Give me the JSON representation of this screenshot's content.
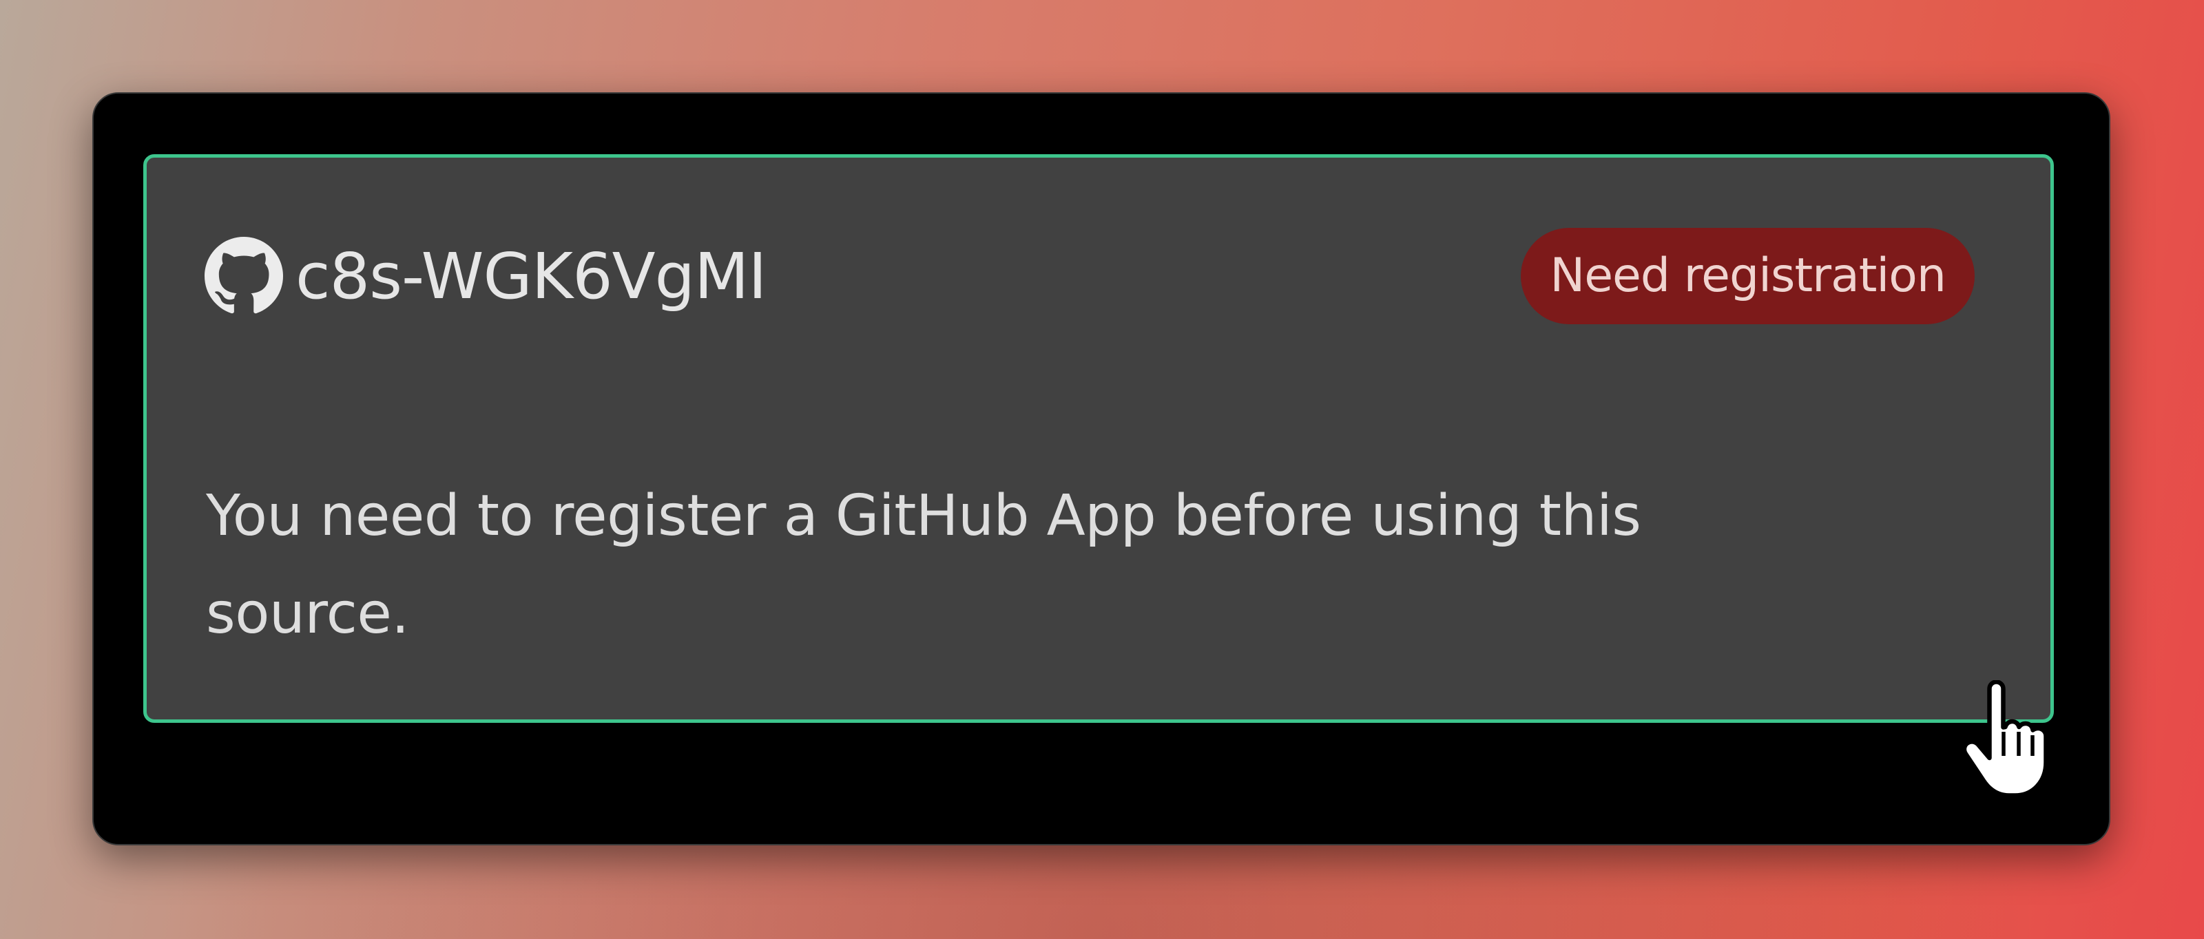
{
  "source_card": {
    "icon": "github-icon",
    "name": "c8s-WGK6VgMI",
    "status_badge": "Need registration",
    "message": "You need to register a GitHub App before using this source."
  },
  "cursor": {
    "icon": "hand-pointer-icon"
  },
  "colors": {
    "window_background": "#000000",
    "card_background": "#414141",
    "card_border": "#3ec58d",
    "badge_background": "#7d1a1a",
    "badge_text": "#f0d4d0",
    "text": "#e6e6e6"
  }
}
